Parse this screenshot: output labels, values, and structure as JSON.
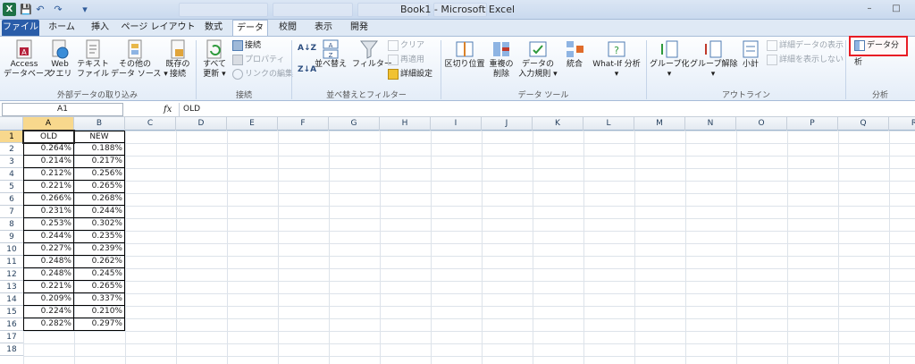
{
  "window": {
    "title": "Book1 - Microsoft Excel",
    "app_letter": "X",
    "minimize": "–",
    "maximize": "□"
  },
  "qat": {
    "save": "💾",
    "undo": "↶",
    "redo": "↷",
    "more": "▾"
  },
  "tabs": [
    "ファイル",
    "ホーム",
    "挿入",
    "ページ レイアウト",
    "数式",
    "データ",
    "校閲",
    "表示",
    "開発"
  ],
  "ribbon": {
    "external": {
      "access": [
        "Access",
        "データベース"
      ],
      "web": [
        "Web",
        "クエリ"
      ],
      "text": [
        "テキスト",
        "ファイル"
      ],
      "other": [
        "その他の",
        "データ ソース ▾"
      ],
      "existing": [
        "既存の",
        "接続"
      ],
      "label": "外部データの取り込み"
    },
    "connections": {
      "refresh": [
        "すべて",
        "更新 ▾"
      ],
      "connect": "接続",
      "props": "プロパティ",
      "edit_links": "リンクの編集",
      "label": "接続"
    },
    "sort": {
      "sort": "並べ替え",
      "filter": "フィルター",
      "clear": "クリア",
      "reapply": "再適用",
      "advanced": "詳細設定",
      "label": "並べ替えとフィルター"
    },
    "tools": {
      "text_to_columns": "区切り位置",
      "remove_dup": [
        "重複の",
        "削除"
      ],
      "validation": [
        "データの",
        "入力規則 ▾"
      ],
      "consolidate": "統合",
      "whatif": [
        "What-If 分析",
        "▾"
      ],
      "label": "データ ツール"
    },
    "outline": {
      "group": [
        "グループ化",
        "▾"
      ],
      "ungroup": [
        "グループ解除",
        "▾"
      ],
      "subtotal": "小計",
      "show_detail": "詳細データの表示",
      "hide_detail": "詳細を表示しない",
      "label": "アウトライン"
    },
    "analysis": {
      "button": "データ分析",
      "label": "分析"
    }
  },
  "formula_bar": {
    "name_box": "A1",
    "fx": "fx",
    "content": "OLD"
  },
  "columns": [
    "A",
    "B",
    "C",
    "D",
    "E",
    "F",
    "G",
    "H",
    "I",
    "J",
    "K",
    "L",
    "M",
    "N",
    "O",
    "P",
    "Q",
    "R"
  ],
  "rows": [
    "1",
    "2",
    "3",
    "4",
    "5",
    "6",
    "7",
    "8",
    "9",
    "10",
    "11",
    "12",
    "13",
    "14",
    "15",
    "16",
    "17",
    "18"
  ],
  "sheet": {
    "headers": [
      "OLD",
      "NEW"
    ],
    "old": [
      "0.264%",
      "0.214%",
      "0.212%",
      "0.221%",
      "0.266%",
      "0.231%",
      "0.253%",
      "0.244%",
      "0.227%",
      "0.248%",
      "0.248%",
      "0.221%",
      "0.209%",
      "0.224%",
      "0.282%"
    ],
    "new": [
      "0.188%",
      "0.217%",
      "0.256%",
      "0.265%",
      "0.268%",
      "0.244%",
      "0.302%",
      "0.235%",
      "0.239%",
      "0.262%",
      "0.245%",
      "0.265%",
      "0.337%",
      "0.210%",
      "0.297%"
    ]
  }
}
